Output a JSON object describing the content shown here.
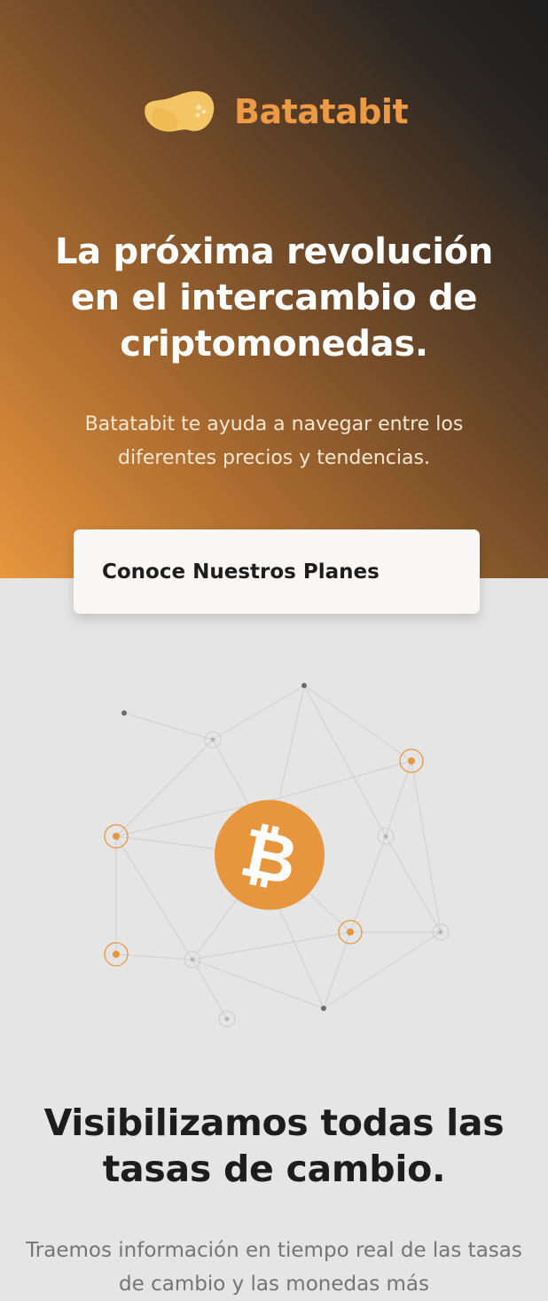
{
  "header": {
    "brand_name": "Batatabit",
    "logo_icon": "potato-logo-icon"
  },
  "hero": {
    "title": "La próxima revolución en el intercambio de criptomonedas.",
    "subtitle": "Batatabit te ayuda a navegar entre los diferentes precios y tendencias.",
    "cta_label": "Conoce Nuestros Planes"
  },
  "illustration": {
    "icon": "bitcoin-icon",
    "glyph": "₿"
  },
  "rates_section": {
    "title": "Visibilizamos todas las tasas de cambio.",
    "text": "Traemos información en tiempo real de las tasas de cambio y las monedas más"
  },
  "colors": {
    "accent": "#ed9a45",
    "dark": "#1d1d1d",
    "light_bg": "#e5e5e5",
    "button_bg": "#f8f7f5",
    "node_orange": "#e8963e"
  }
}
